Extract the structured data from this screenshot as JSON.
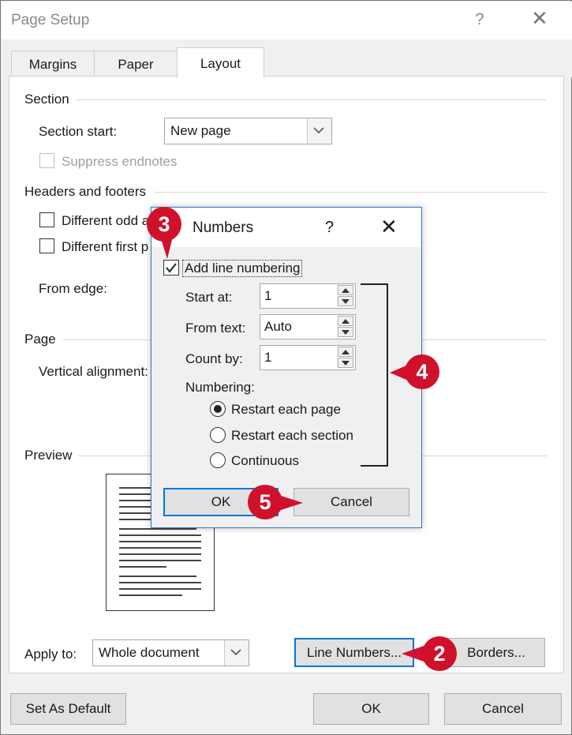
{
  "window": {
    "title": "Page Setup",
    "help": "?",
    "close": "✕"
  },
  "tabs": [
    {
      "label": "Margins"
    },
    {
      "label": "Paper"
    },
    {
      "label": "Layout"
    }
  ],
  "section": {
    "heading": "Section",
    "start_label": "Section start:",
    "start_value": "New page",
    "suppress_label": "Suppress endnotes"
  },
  "headers_footers": {
    "heading": "Headers and footers",
    "odd_even_label": "Different odd a",
    "first_page_label": "Different first p",
    "from_edge_label": "From edge:"
  },
  "page": {
    "heading": "Page",
    "vertical_label": "Vertical alignment:"
  },
  "preview": {
    "heading": "Preview"
  },
  "apply": {
    "label": "Apply to:",
    "value": "Whole document"
  },
  "buttons": {
    "line_numbers": "Line Numbers...",
    "borders": "Borders...",
    "set_default": "Set As Default",
    "ok": "OK",
    "cancel": "Cancel"
  },
  "line_dialog": {
    "title": "Numbers",
    "help": "?",
    "close": "✕",
    "add_label": "Add line numbering",
    "add_checked": true,
    "start_label": "Start at:",
    "start_value": "1",
    "from_label": "From text:",
    "from_value": "Auto",
    "count_label": "Count by:",
    "count_value": "1",
    "numbering_label": "Numbering:",
    "options": [
      {
        "label": "Restart each page",
        "selected": true
      },
      {
        "label": "Restart each section",
        "selected": false
      },
      {
        "label": "Continuous",
        "selected": false
      }
    ],
    "ok": "OK",
    "cancel": "Cancel"
  },
  "callouts": {
    "c2": "2",
    "c3": "3",
    "c4": "4",
    "c5": "5"
  },
  "colors": {
    "accent": "#0078d7",
    "callout": "#d0112b"
  }
}
